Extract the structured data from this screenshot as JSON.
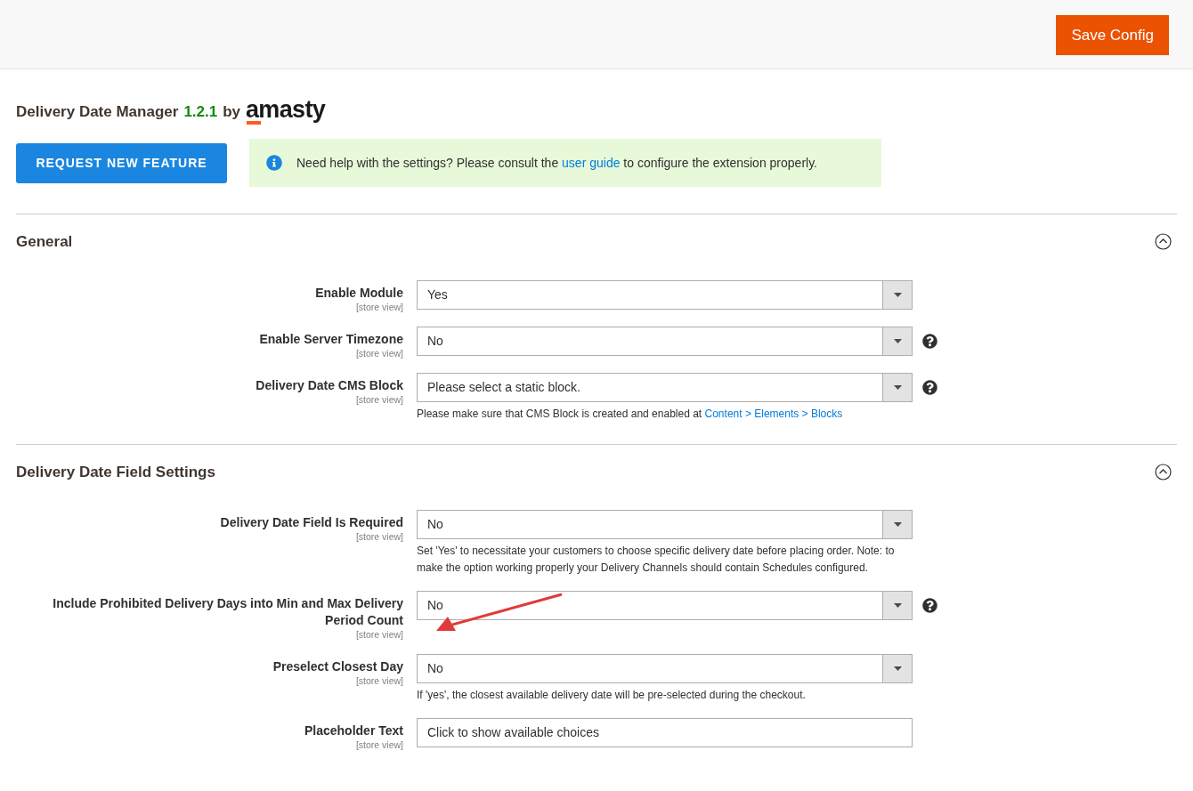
{
  "header": {
    "save_button": "Save Config"
  },
  "title": {
    "name": "Delivery Date Manager",
    "version": "1.2.1",
    "by": "by",
    "logo": "amasty"
  },
  "request_button": "REQUEST NEW FEATURE",
  "notice": {
    "before": "Need help with the settings? Please consult the",
    "link": "user guide",
    "after": "to configure the extension properly."
  },
  "sections": [
    {
      "title": "General",
      "expanded": true,
      "fields": [
        {
          "label": "Enable Module",
          "scope": "[store view]",
          "kind": "select",
          "value": "Yes",
          "help": false
        },
        {
          "label": "Enable Server Timezone",
          "scope": "[store view]",
          "kind": "select",
          "value": "No",
          "help": true
        },
        {
          "label": "Delivery Date CMS Block",
          "scope": "[store view]",
          "kind": "select",
          "value": "Please select a static block.",
          "help": true,
          "note": "Please make sure that CMS Block is created and enabled at",
          "note_link": "Content > Elements > Blocks"
        }
      ]
    },
    {
      "title": "Delivery Date Field Settings",
      "expanded": true,
      "fields": [
        {
          "label": "Delivery Date Field Is Required",
          "scope": "[store view]",
          "kind": "select",
          "value": "No",
          "help": false,
          "note": "Set 'Yes' to necessitate your customers to choose specific delivery date before placing order. Note: to make the option working properly your Delivery Channels should contain Schedules configured."
        },
        {
          "label": "Include Prohibited Delivery Days into Min and Max Delivery Period Count",
          "scope": "[store view]",
          "kind": "select",
          "value": "No",
          "help": true
        },
        {
          "label": "Preselect Closest Day",
          "scope": "[store view]",
          "kind": "select",
          "value": "No",
          "help": false,
          "note": "If 'yes', the closest available delivery date will be pre-selected during the checkout."
        },
        {
          "label": "Placeholder Text",
          "scope": "[store view]",
          "kind": "text",
          "value": "Click to show available choices",
          "help": false
        }
      ]
    }
  ]
}
